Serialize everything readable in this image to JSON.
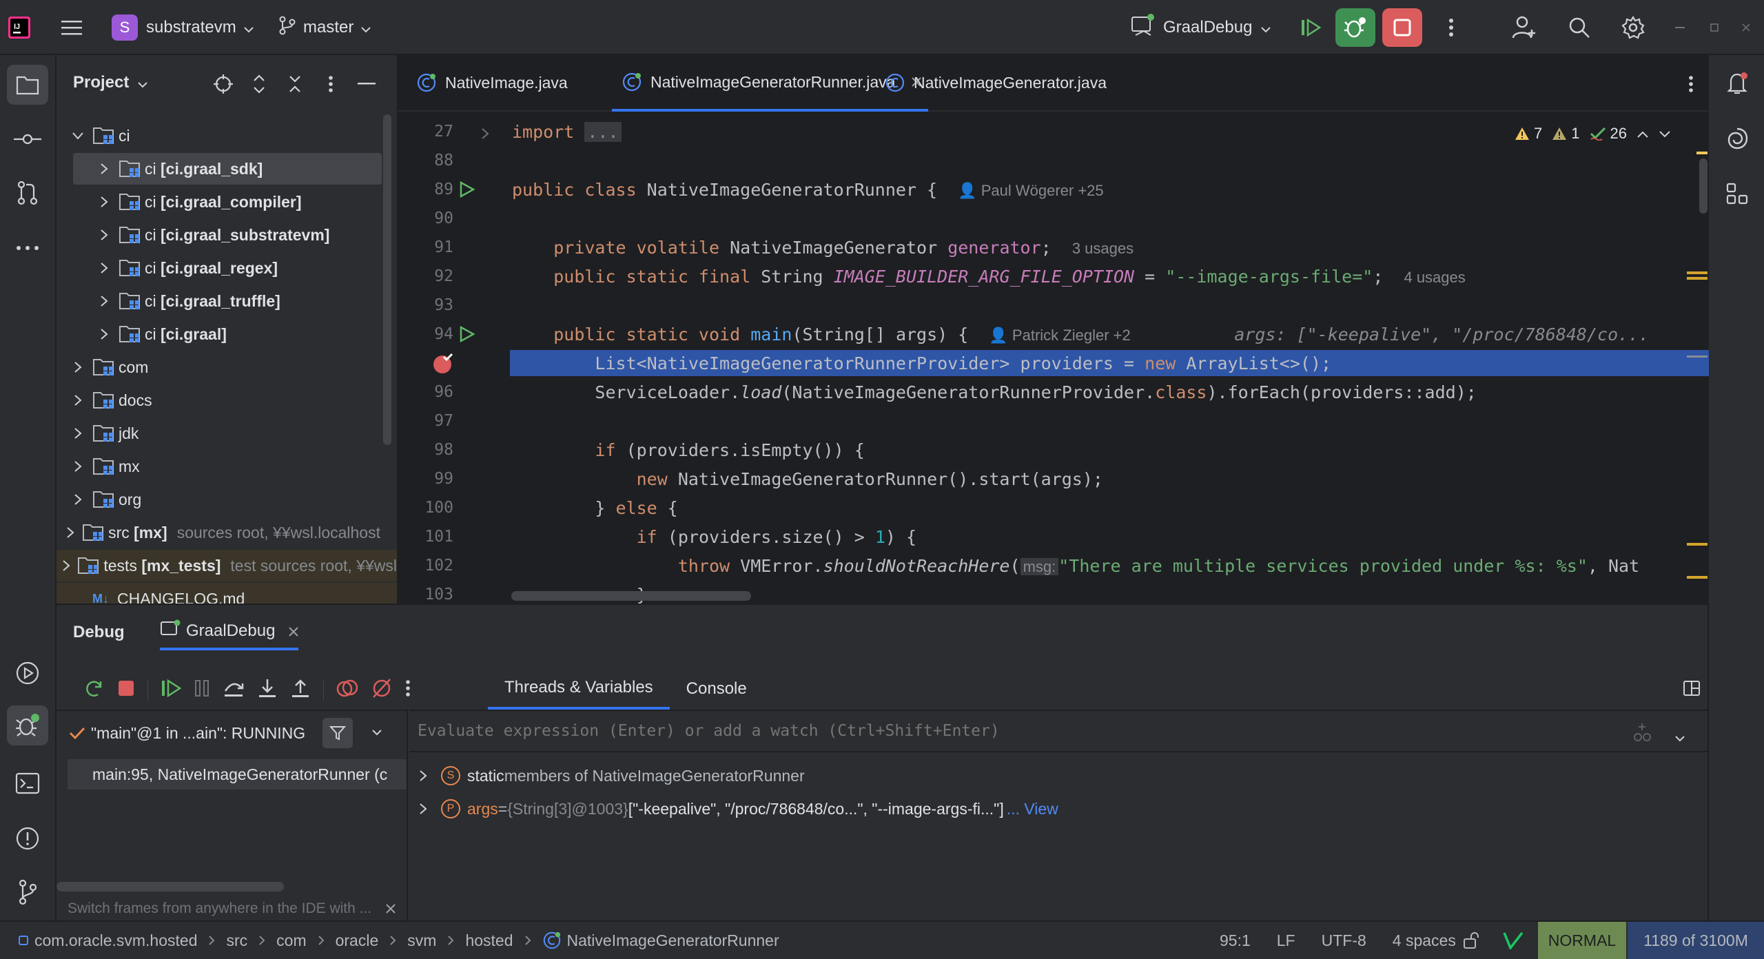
{
  "titlebar": {
    "project_letter": "S",
    "project_name": "substratevm",
    "branch": "master",
    "run_config": "GraalDebug"
  },
  "project_panel": {
    "title": "Project",
    "items": [
      {
        "name": "ci",
        "extra": "",
        "level": 0,
        "expanded": true
      },
      {
        "name": "ci [ci.graal_sdk]",
        "extra": "",
        "level": 1,
        "selected": true
      },
      {
        "name": "ci [ci.graal_compiler]",
        "extra": "",
        "level": 1
      },
      {
        "name": "ci [ci.graal_substratevm]",
        "extra": "",
        "level": 1
      },
      {
        "name": "ci [ci.graal_regex]",
        "extra": "",
        "level": 1
      },
      {
        "name": "ci [ci.graal_truffle]",
        "extra": "",
        "level": 1
      },
      {
        "name": "ci [ci.graal]",
        "extra": "",
        "level": 1
      },
      {
        "name": "com",
        "extra": "",
        "level": 0
      },
      {
        "name": "docs",
        "extra": "",
        "level": 0
      },
      {
        "name": "jdk",
        "extra": "",
        "level": 0
      },
      {
        "name": "mx",
        "extra": "",
        "level": 0
      },
      {
        "name": "org",
        "extra": "",
        "level": 0
      },
      {
        "name": "src [mx]",
        "extra": "sources root, ¥¥wsl.localhost",
        "level": 0
      },
      {
        "name": "tests [mx_tests]",
        "extra": "test sources root, ¥¥wsl",
        "level": 0
      },
      {
        "name": "CHANGELOG.md",
        "extra": "",
        "level": 0,
        "file": true
      }
    ]
  },
  "editor": {
    "tabs": [
      {
        "label": "NativeImage.java"
      },
      {
        "label": "NativeImageGeneratorRunner.java",
        "active": true
      },
      {
        "label": "NativeImageGenerator.java"
      }
    ],
    "inspections": {
      "warnings": "7",
      "weak": "1",
      "ok": "26"
    },
    "lines": [
      {
        "n": "27",
        "html": "<span class=\"kw\">import</span> <span style=\"background:#393b40;color:#868a91;padding:0 4px\">...</span>"
      },
      {
        "n": "88",
        "html": ""
      },
      {
        "n": "89",
        "html": "<span class=\"kw\">public class</span> NativeImageGeneratorRunner {  <span class=\"hint\">&#128100; Paul Wögerer +25</span>",
        "run": true
      },
      {
        "n": "90",
        "html": ""
      },
      {
        "n": "91",
        "html": "    <span class=\"kw\">private volatile</span> NativeImageGenerator <span class=\"fld\">generator</span>;  <span class=\"hint\">3 usages</span>"
      },
      {
        "n": "92",
        "html": "    <span class=\"kw\">public static final</span> String <span class=\"fld\" style=\"font-style:italic\">IMAGE_BUILDER_ARG_FILE_OPTION</span> = <span class=\"str\">\"--image-args-file=\"</span>;  <span class=\"hint\">4 usages</span>"
      },
      {
        "n": "93",
        "html": ""
      },
      {
        "n": "94",
        "html": "    <span class=\"kw\">public static void</span> <span class=\"fn\">main</span>(String[] args) {  <span class=\"hint\">&#128100; Patrick Ziegler +2</span>          <span style=\"color:#868a91;font-style:italic\">args: [\"-keepalive\", \"/proc/786848/co...</span>",
        "run": true
      },
      {
        "n": "",
        "html": "        List&lt;NativeImageGeneratorRunnerProvider&gt; providers = <span class=\"kw\">new</span> ArrayList&lt;&gt;();",
        "bp": true
      },
      {
        "n": "96",
        "html": "        ServiceLoader.<span style=\"font-style:italic\">load</span>(NativeImageGeneratorRunnerProvider.<span class=\"kw\">class</span>).forEach(providers::add);"
      },
      {
        "n": "97",
        "html": ""
      },
      {
        "n": "98",
        "html": "        <span class=\"kw\">if</span> (providers.isEmpty()) {"
      },
      {
        "n": "99",
        "html": "            <span class=\"kw\">new</span> NativeImageGeneratorRunner().start(args);"
      },
      {
        "n": "100",
        "html": "        } <span class=\"kw\">else</span> {"
      },
      {
        "n": "101",
        "html": "            <span class=\"kw\">if</span> (providers.size() &gt; <span class=\"num\">1</span>) {"
      },
      {
        "n": "102",
        "html": "                <span class=\"kw\">throw</span> VMError.<span style=\"font-style:italic\">shouldNotReachHere</span>(<span class=\"hint\" style=\"background:#393b40;padding:0 4px\">msg:</span><span class=\"str\">\"There are multiple services provided under %s: %s\"</span>, Nat"
      },
      {
        "n": "103",
        "html": "            }"
      }
    ]
  },
  "debug": {
    "title": "Debug",
    "session": "GraalDebug",
    "tabs": [
      "Threads & Variables",
      "Console"
    ],
    "thread": "\"main\"@1 in ...ain\": RUNNING",
    "frame": "main:95, NativeImageGeneratorRunner (c",
    "eval_placeholder": "Evaluate expression (Enter) or add a watch (Ctrl+Shift+Enter)",
    "vars": [
      {
        "badge": "S",
        "name": "static",
        "rest": " members of NativeImageGeneratorRunner",
        "view": ""
      },
      {
        "badge": "P",
        "name": "args",
        "rest": " = ",
        "type": "{String[3]@1003}",
        "value": " [\"-keepalive\", \"/proc/786848/co...\", \"--image-args-fi...\"]",
        "view": "... View"
      }
    ],
    "hint": "Switch frames from anywhere in the IDE with ..."
  },
  "statusbar": {
    "crumbs": [
      "com.oracle.svm.hosted",
      "src",
      "com",
      "oracle",
      "svm",
      "hosted",
      "NativeImageGeneratorRunner"
    ],
    "position": "95:1",
    "line_sep": "LF",
    "encoding": "UTF-8",
    "indent": "4 spaces",
    "mode": "NORMAL",
    "memory": "1189 of 3100M"
  },
  "colors": {
    "accent": "#2e55a6",
    "run_green": "#3f9153",
    "stop_red": "#db5c5c",
    "vim_mode_bg": "#6d8a52"
  }
}
